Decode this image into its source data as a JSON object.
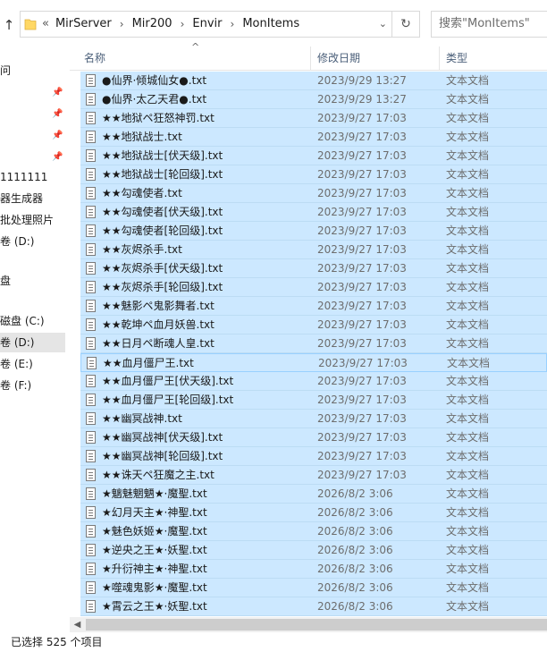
{
  "address": {
    "overflow": "«",
    "crumbs": [
      "MirServer",
      "Mir200",
      "Envir",
      "MonItems"
    ],
    "dropdown": "⌄",
    "refresh": "↻"
  },
  "search": {
    "placeholder": "搜索\"MonItems\""
  },
  "nav": {
    "items": [
      "问",
      "",
      "",
      "",
      "",
      "1111111",
      "器生成器",
      "批处理照片",
      "卷 (D:)",
      "",
      "盘",
      "",
      "磁盘 (C:)",
      "卷 (D:)",
      "卷 (E:)",
      "卷 (F:)"
    ]
  },
  "columns": {
    "name": "名称",
    "date": "修改日期",
    "type": "类型"
  },
  "files": [
    {
      "name": "●仙界·倾城仙女●.txt",
      "date": "2023/9/29 13:27",
      "type": "文本文档"
    },
    {
      "name": "●仙界·太乙天君●.txt",
      "date": "2023/9/29 13:27",
      "type": "文本文档"
    },
    {
      "name": "★★地狱ペ狂怒神罚.txt",
      "date": "2023/9/27 17:03",
      "type": "文本文档"
    },
    {
      "name": "★★地狱战士.txt",
      "date": "2023/9/27 17:03",
      "type": "文本文档"
    },
    {
      "name": "★★地狱战士[伏天级].txt",
      "date": "2023/9/27 17:03",
      "type": "文本文档"
    },
    {
      "name": "★★地狱战士[轮回级].txt",
      "date": "2023/9/27 17:03",
      "type": "文本文档"
    },
    {
      "name": "★★勾魂使者.txt",
      "date": "2023/9/27 17:03",
      "type": "文本文档"
    },
    {
      "name": "★★勾魂使者[伏天级].txt",
      "date": "2023/9/27 17:03",
      "type": "文本文档"
    },
    {
      "name": "★★勾魂使者[轮回级].txt",
      "date": "2023/9/27 17:03",
      "type": "文本文档"
    },
    {
      "name": "★★灰烬杀手.txt",
      "date": "2023/9/27 17:03",
      "type": "文本文档"
    },
    {
      "name": "★★灰烬杀手[伏天级].txt",
      "date": "2023/9/27 17:03",
      "type": "文本文档"
    },
    {
      "name": "★★灰烬杀手[轮回级].txt",
      "date": "2023/9/27 17:03",
      "type": "文本文档"
    },
    {
      "name": "★★魅影ペ鬼影舞者.txt",
      "date": "2023/9/27 17:03",
      "type": "文本文档"
    },
    {
      "name": "★★乾坤ペ血月妖兽.txt",
      "date": "2023/9/27 17:03",
      "type": "文本文档"
    },
    {
      "name": "★★日月ペ断魂人皇.txt",
      "date": "2023/9/27 17:03",
      "type": "文本文档"
    },
    {
      "name": "★★血月僵尸王.txt",
      "date": "2023/9/27 17:03",
      "type": "文本文档"
    },
    {
      "name": "★★血月僵尸王[伏天级].txt",
      "date": "2023/9/27 17:03",
      "type": "文本文档"
    },
    {
      "name": "★★血月僵尸王[轮回级].txt",
      "date": "2023/9/27 17:03",
      "type": "文本文档"
    },
    {
      "name": "★★幽冥战神.txt",
      "date": "2023/9/27 17:03",
      "type": "文本文档"
    },
    {
      "name": "★★幽冥战神[伏天级].txt",
      "date": "2023/9/27 17:03",
      "type": "文本文档"
    },
    {
      "name": "★★幽冥战神[轮回级].txt",
      "date": "2023/9/27 17:03",
      "type": "文本文档"
    },
    {
      "name": "★★诛天ペ狂魔之主.txt",
      "date": "2023/9/27 17:03",
      "type": "文本文档"
    },
    {
      "name": "★魑魅魍魉★·魔聖.txt",
      "date": "2026/8/2 3:06",
      "type": "文本文档"
    },
    {
      "name": "★幻月天主★·神聖.txt",
      "date": "2026/8/2 3:06",
      "type": "文本文档"
    },
    {
      "name": "★魅色妖姬★·魔聖.txt",
      "date": "2026/8/2 3:06",
      "type": "文本文档"
    },
    {
      "name": "★逆央之王★·妖聖.txt",
      "date": "2026/8/2 3:06",
      "type": "文本文档"
    },
    {
      "name": "★升衍神主★·神聖.txt",
      "date": "2026/8/2 3:06",
      "type": "文本文档"
    },
    {
      "name": "★噬魂鬼影★·魔聖.txt",
      "date": "2026/8/2 3:06",
      "type": "文本文档"
    },
    {
      "name": "★霄云之王★·妖聖.txt",
      "date": "2026/8/2 3:06",
      "type": "文本文档"
    }
  ],
  "status": {
    "text": "已选择 525 个项目"
  },
  "colors": {
    "selection": "#cce8ff",
    "header_text": "#4c607a",
    "nav_selected": "#e5e5e5"
  }
}
